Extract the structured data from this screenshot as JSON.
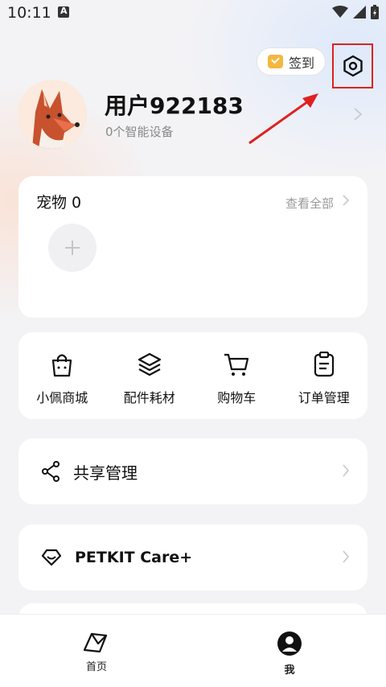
{
  "status_bar": {
    "time": "10:11"
  },
  "header": {
    "checkin_label": "签到"
  },
  "profile": {
    "username": "用户922183",
    "device_count": "0个智能设备"
  },
  "pets": {
    "title": "宠物 0",
    "view_all": "查看全部"
  },
  "shortcuts": [
    {
      "label": "小佩商城",
      "icon": "shopping-bag-icon"
    },
    {
      "label": "配件耗材",
      "icon": "layers-icon"
    },
    {
      "label": "购物车",
      "icon": "cart-icon"
    },
    {
      "label": "订单管理",
      "icon": "clipboard-icon"
    }
  ],
  "share": {
    "label": "共享管理",
    "icon": "share-icon"
  },
  "care": {
    "label": "PETKIT Care+",
    "icon": "care-heart-icon"
  },
  "bottom_nav": {
    "home_label": "首页",
    "me_label": "我"
  },
  "colors": {
    "accent_checkin": "#f4b740",
    "highlight": "#e02020",
    "background": "#f3f3f6"
  }
}
